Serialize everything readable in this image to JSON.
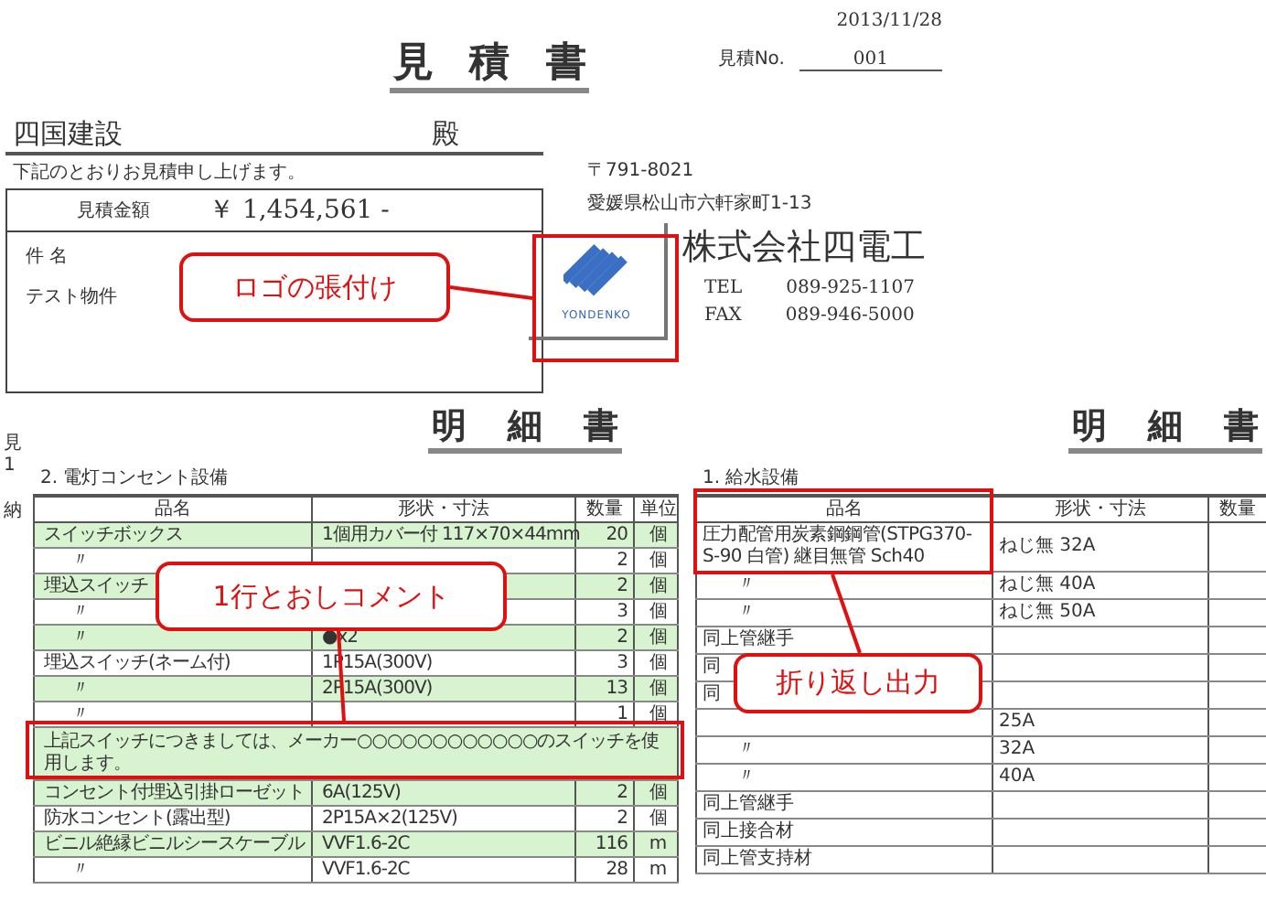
{
  "quote": {
    "title": "見 積 書",
    "date": "2013/11/28",
    "number_label": "見積No.",
    "number": "001",
    "customer": "四国建設",
    "honorific": "殿",
    "intro": "下記のとおりお見積申し上げます。",
    "amount_label": "見積金額",
    "amount": "￥ 1,454,561 -",
    "subject_label": "件 名",
    "subject": "テスト物件",
    "postal": "〒791-8021",
    "address": "愛媛県松山市六軒家町1-13",
    "logo_text": "YONDENKO",
    "company": "株式会社四電工",
    "contacts": [
      {
        "label": "TEL",
        "value": "089-925-1107"
      },
      {
        "label": "FAX",
        "value": "089-946-5000"
      }
    ]
  },
  "left_sheet": {
    "side_notes": [
      "見1",
      "納"
    ],
    "title": "明 細 書",
    "section": "2. 電灯コンセント設備",
    "columns": [
      "品名",
      "形状・寸法",
      "数量",
      "単位"
    ],
    "rows": [
      {
        "kind": "item",
        "highlighted": true,
        "name": "スイッチボックス",
        "spec": "1個用カバー付 117×70×44mm",
        "qty": "20",
        "unit": "個"
      },
      {
        "kind": "item",
        "highlighted": false,
        "name": "〃",
        "qty": "2",
        "unit": "個"
      },
      {
        "kind": "item",
        "highlighted": true,
        "name": "埋込スイッチ",
        "qty": "2",
        "unit": "個"
      },
      {
        "kind": "item",
        "highlighted": false,
        "name": "〃",
        "qty": "3",
        "unit": "個"
      },
      {
        "kind": "item",
        "highlighted": true,
        "name": "〃",
        "spec": "●x2",
        "qty": "2",
        "unit": "個"
      },
      {
        "kind": "item",
        "highlighted": false,
        "name": "埋込スイッチ(ネーム付)",
        "spec": "1P15A(300V)",
        "qty": "3",
        "unit": "個"
      },
      {
        "kind": "item",
        "highlighted": true,
        "name": "〃",
        "spec": "2P15A(300V)",
        "qty": "13",
        "unit": "個"
      },
      {
        "kind": "item",
        "highlighted": false,
        "name": "〃",
        "qty": "1",
        "unit": "個"
      },
      {
        "kind": "comment",
        "highlighted": true,
        "text": "上記スイッチにつきましては、メーカー○○○○○○○○○○○○のスイッチを使用します。"
      },
      {
        "kind": "item",
        "highlighted": true,
        "name": "コンセント付埋込引掛ローゼット",
        "spec": "6A(125V)",
        "qty": "2",
        "unit": "個"
      },
      {
        "kind": "item",
        "highlighted": false,
        "name": "防水コンセント(露出型)",
        "spec": "2P15A×2(125V)",
        "qty": "2",
        "unit": "個"
      },
      {
        "kind": "item",
        "highlighted": true,
        "name": "ビニル絶縁ビニルシースケーブル",
        "spec": "VVF1.6-2C",
        "qty": "116",
        "unit": "m"
      },
      {
        "kind": "item",
        "highlighted": false,
        "name": "〃",
        "spec": "VVF1.6-2C",
        "qty": "28",
        "unit": "m"
      }
    ]
  },
  "right_sheet": {
    "title": "明 細 書",
    "section": "1. 給水設備",
    "columns": [
      "品名",
      "形状・寸法",
      "数量"
    ],
    "rows": [
      {
        "name": "圧力配管用炭素鋼鋼管(STPG370-S-90 白管) 継目無管 Sch40",
        "spec": "ねじ無 32A"
      },
      {
        "name": "〃",
        "spec": "ねじ無 40A"
      },
      {
        "name": "〃",
        "spec": "ねじ無 50A"
      },
      {
        "name": "同上管継手"
      },
      {
        "name": "同"
      },
      {
        "name": "同"
      },
      {
        "spec": "25A"
      },
      {
        "name": "〃",
        "spec": "32A"
      },
      {
        "name": "〃",
        "spec": "40A"
      },
      {
        "name": "同上管継手"
      },
      {
        "name": "同上接合材"
      },
      {
        "name": "同上管支持材"
      }
    ]
  },
  "callouts": [
    {
      "text": "ロゴの張付け"
    },
    {
      "text": "1行とおしコメント"
    },
    {
      "text": "折り返し出力"
    }
  ]
}
